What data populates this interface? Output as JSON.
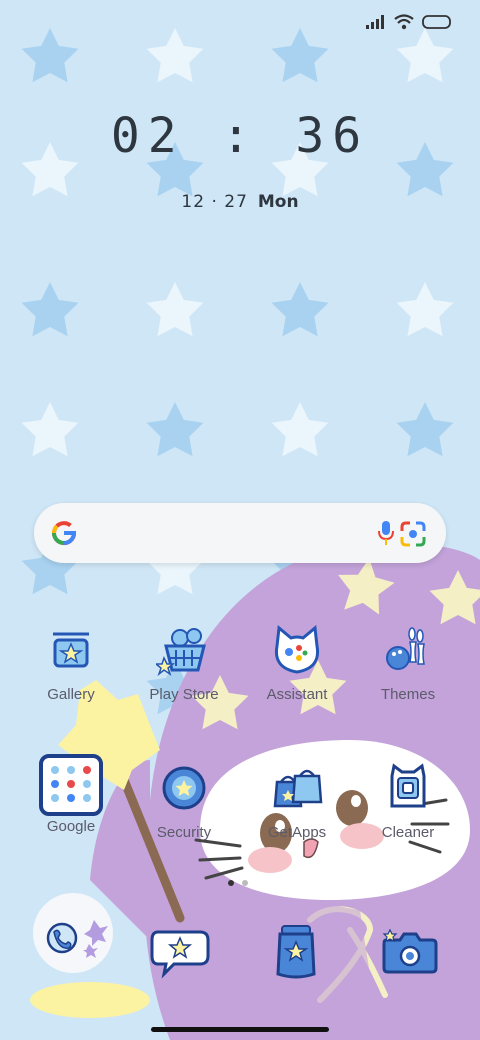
{
  "status": {
    "signal": "signal-icon",
    "wifi": "wifi-icon",
    "battery": "battery-icon"
  },
  "clock": {
    "time": "02 : 36"
  },
  "date": {
    "day_month": "12 · 27",
    "weekday": "Mon"
  },
  "search": {
    "google": "google-g-icon",
    "mic": "microphone-icon",
    "lens": "lens-camera-icon"
  },
  "apps": {
    "gallery": "Gallery",
    "play_store": "Play Store",
    "assistant": "Assistant",
    "themes": "Themes",
    "google": "Google",
    "security": "Security",
    "getapps": "GetApps",
    "cleaner": "Cleaner"
  },
  "dock": [
    "phone-icon",
    "messages-icon",
    "browser-icon",
    "camera-icon"
  ],
  "pages": {
    "count": 2,
    "active": 0
  },
  "colors": {
    "wallpaper": "#cfe6f6",
    "star_dark": "#a8d2f0",
    "star_light": "#eaf5fc",
    "hat": "#c3a3da",
    "wand_star": "#fbf2a2",
    "icon_blue": "#2457b5"
  }
}
